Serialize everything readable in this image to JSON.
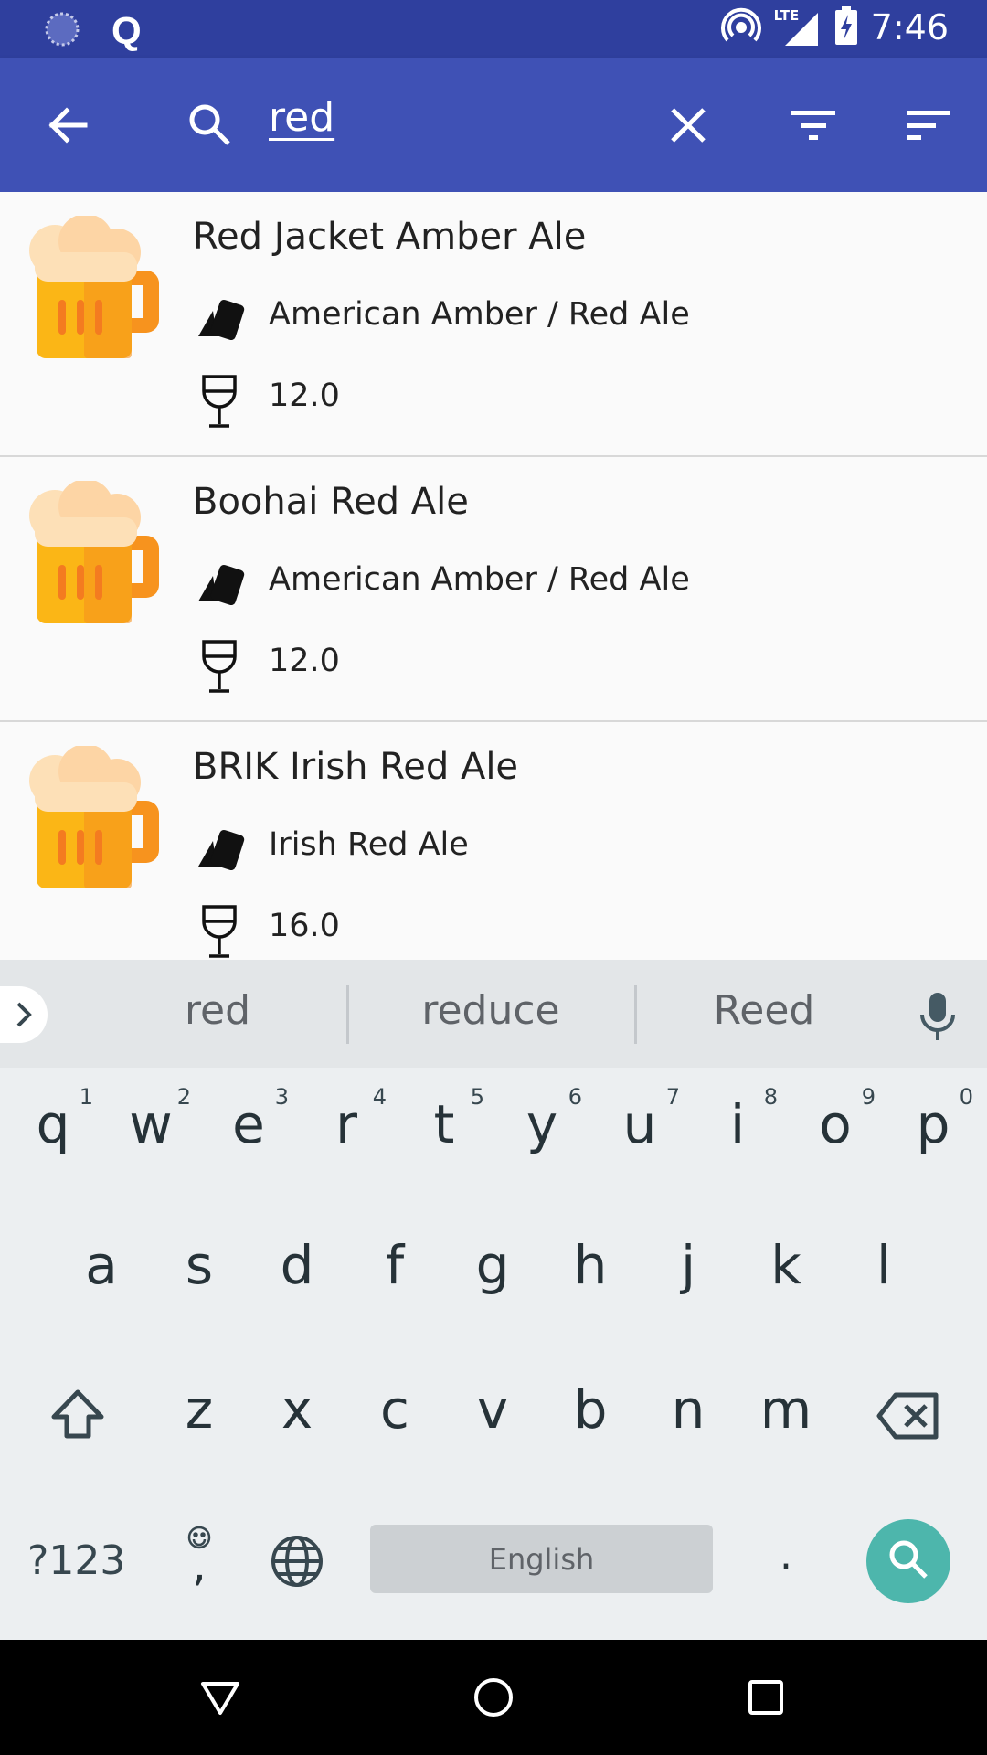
{
  "status_bar": {
    "time": "7:46",
    "network": "LTE",
    "app_letter": "Q"
  },
  "app_bar": {
    "query": "red"
  },
  "beers": [
    {
      "name": "Red Jacket Amber Ale",
      "style": "American Amber / Red Ale",
      "abv": "12.0"
    },
    {
      "name": "Boohai Red Ale",
      "style": "American Amber / Red Ale",
      "abv": "12.0"
    },
    {
      "name": "BRIK Irish Red Ale",
      "style": "Irish Red Ale",
      "abv": "16.0"
    }
  ],
  "keyboard": {
    "suggestions": [
      "red",
      "reduce",
      "Reed"
    ],
    "row1": [
      {
        "letter": "q",
        "hint": "1"
      },
      {
        "letter": "w",
        "hint": "2"
      },
      {
        "letter": "e",
        "hint": "3"
      },
      {
        "letter": "r",
        "hint": "4"
      },
      {
        "letter": "t",
        "hint": "5"
      },
      {
        "letter": "y",
        "hint": "6"
      },
      {
        "letter": "u",
        "hint": "7"
      },
      {
        "letter": "i",
        "hint": "8"
      },
      {
        "letter": "o",
        "hint": "9"
      },
      {
        "letter": "p",
        "hint": "0"
      }
    ],
    "row2": [
      "a",
      "s",
      "d",
      "f",
      "g",
      "h",
      "j",
      "k",
      "l"
    ],
    "row3": [
      "z",
      "x",
      "c",
      "v",
      "b",
      "n",
      "m"
    ],
    "symbols_label": "?123",
    "comma": ",",
    "period": ".",
    "space_label": "English"
  },
  "colors": {
    "status_bar": "#2f3f9e",
    "app_bar": "#3f51b5",
    "search_key": "#4db6ac"
  }
}
